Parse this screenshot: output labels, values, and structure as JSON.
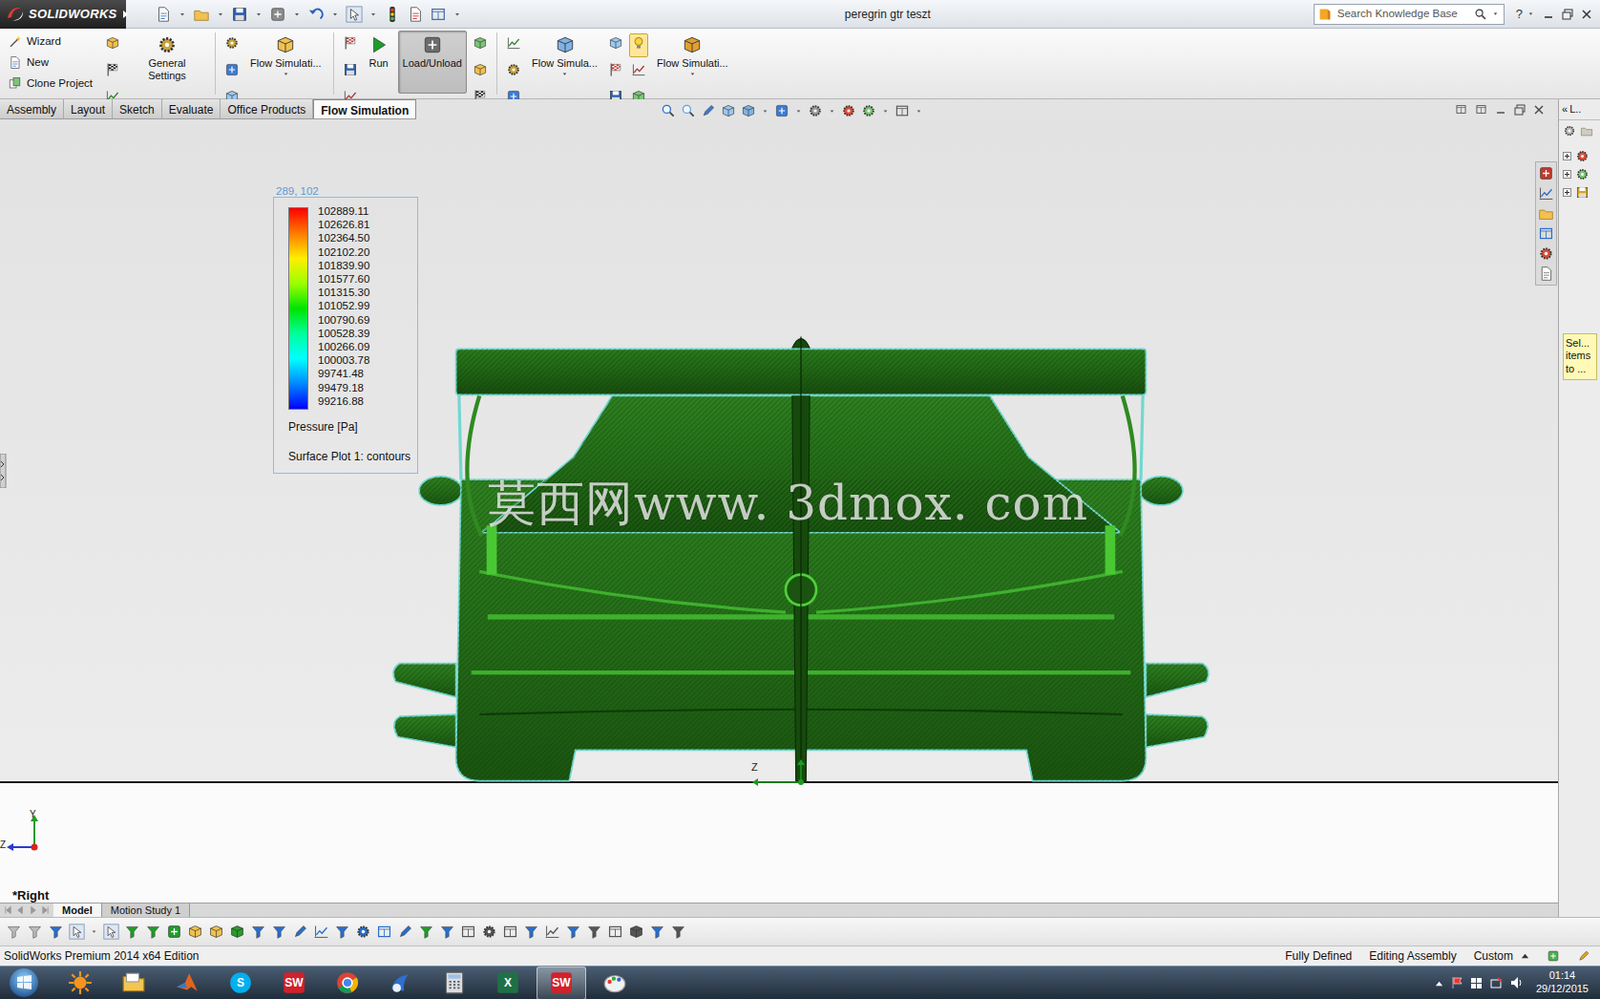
{
  "window": {
    "app": "SOLIDWORKS",
    "title": "peregrin gtr teszt",
    "help": "?"
  },
  "search": {
    "placeholder": "Search Knowledge Base"
  },
  "ribbon": {
    "items": [
      {
        "kind": "list",
        "entries": [
          "Wizard",
          "New",
          "Clone Project"
        ]
      },
      {
        "kind": "stack",
        "toggled": [
          false,
          false,
          false
        ]
      },
      {
        "kind": "large",
        "label": "General Settings",
        "selected": false,
        "dropdown": false
      },
      {
        "kind": "sep"
      },
      {
        "kind": "stack",
        "toggled": [
          false,
          false,
          false
        ]
      },
      {
        "kind": "large",
        "label": "Flow Simulati...",
        "selected": false,
        "dropdown": true
      },
      {
        "kind": "sep"
      },
      {
        "kind": "stack",
        "toggled": [
          false,
          false,
          false
        ]
      },
      {
        "kind": "large",
        "label": "Run",
        "selected": false,
        "dropdown": false
      },
      {
        "kind": "large",
        "label": "Load/Unload",
        "selected": true,
        "dropdown": false
      },
      {
        "kind": "stack",
        "toggled": [
          false,
          false,
          false
        ]
      },
      {
        "kind": "sep"
      },
      {
        "kind": "stack",
        "toggled": [
          false,
          false,
          false
        ]
      },
      {
        "kind": "large",
        "label": "Flow Simula...",
        "selected": false,
        "dropdown": true
      },
      {
        "kind": "stack",
        "toggled": [
          false,
          false,
          false
        ]
      },
      {
        "kind": "stack",
        "toggled": [
          true,
          false,
          false
        ]
      },
      {
        "kind": "large",
        "label": "Flow Simulati...",
        "selected": false,
        "dropdown": true
      }
    ]
  },
  "tabs": [
    {
      "label": "Assembly",
      "selected": false
    },
    {
      "label": "Layout",
      "selected": false
    },
    {
      "label": "Sketch",
      "selected": false
    },
    {
      "label": "Evaluate",
      "selected": false
    },
    {
      "label": "Office Products",
      "selected": false
    },
    {
      "label": "Flow Simulation",
      "selected": true
    }
  ],
  "legend": {
    "coords": "289, 102",
    "values": [
      "102889.11",
      "102626.81",
      "102364.50",
      "102102.20",
      "101839.90",
      "101577.60",
      "101315.30",
      "101052.99",
      "100790.69",
      "100528.39",
      "100266.09",
      "100003.78",
      "99741.48",
      "99479.18",
      "99216.88"
    ],
    "stops": [
      "#ff0000",
      "#ff7a00",
      "#ffee00",
      "#9cff00",
      "#00e400",
      "#00ff9a",
      "#00ffff",
      "#0088ff",
      "#0000ff"
    ],
    "quantity": "Pressure [Pa]",
    "plot": "Surface Plot 1: contours"
  },
  "watermark": "莫西网www. 3dmox. com",
  "viewport": {
    "origin_axis": "Z",
    "triad": {
      "y": "Y",
      "z": "Z"
    },
    "view": "*Right"
  },
  "task_pane": {
    "collapse": "«",
    "title": "L..",
    "note": "Sel... items to ..."
  },
  "bottom_tabs": [
    {
      "label": "Model",
      "selected": true
    },
    {
      "label": "Motion Study 1",
      "selected": false
    }
  ],
  "status_bar": {
    "edition": "SolidWorks Premium 2014 x64 Edition",
    "items": [
      "Fully Defined",
      "Editing Assembly",
      "Custom"
    ]
  },
  "taskbar": {
    "apps": [
      {
        "kind": "sun",
        "label": "",
        "selected": false
      },
      {
        "kind": "folder",
        "label": "",
        "selected": false
      },
      {
        "kind": "matlab",
        "label": "",
        "selected": false
      },
      {
        "kind": "skype",
        "label": "S",
        "selected": false
      },
      {
        "kind": "sw",
        "label": "SW",
        "selected": false
      },
      {
        "kind": "chrome",
        "label": "",
        "selected": false
      },
      {
        "kind": "mail",
        "label": "",
        "selected": false
      },
      {
        "kind": "calc",
        "label": "",
        "selected": false
      },
      {
        "kind": "excel",
        "label": "X",
        "selected": false
      },
      {
        "kind": "sw",
        "label": "SW",
        "selected": true
      },
      {
        "kind": "paint",
        "label": "",
        "selected": false
      }
    ],
    "time": "01:14",
    "date": "29/12/2015"
  }
}
